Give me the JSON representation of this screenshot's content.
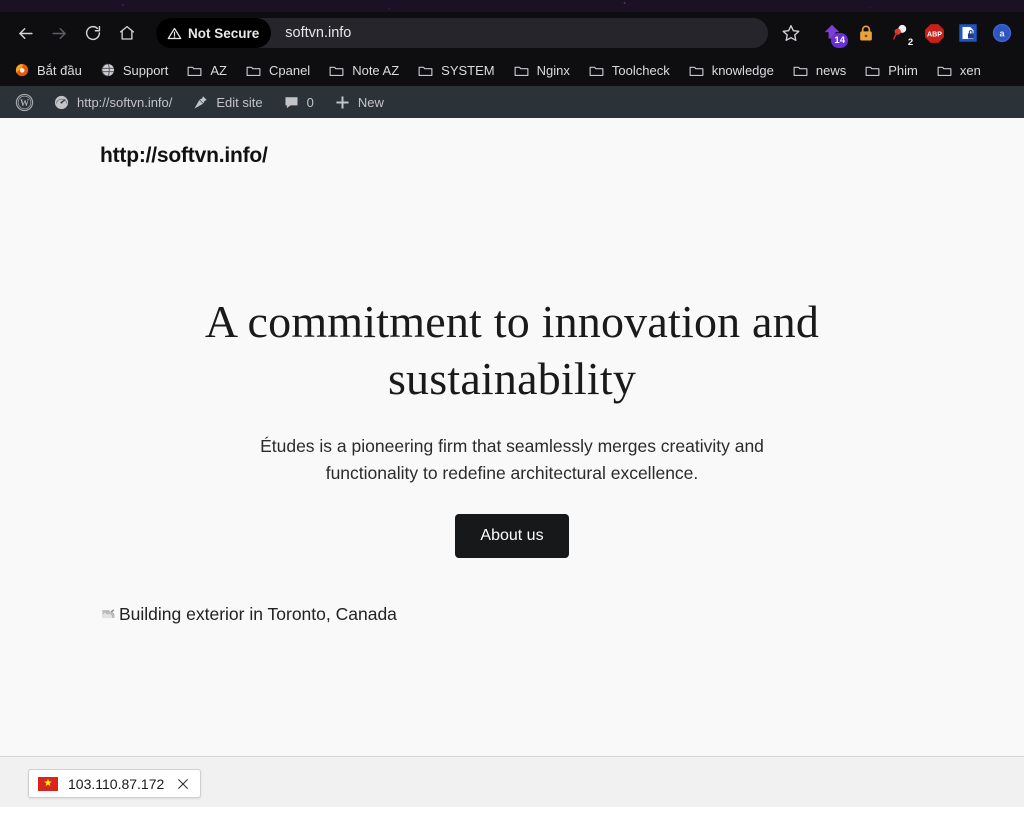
{
  "browser": {
    "nav": {
      "back_title": "Back",
      "forward_title": "Forward",
      "reload_title": "Reload",
      "home_title": "Home",
      "bookmark_title": "Bookmark this page"
    },
    "address": {
      "security_label": "Not Secure",
      "url": "softvn.info"
    },
    "extensions": [
      {
        "name": "upload-extension-icon",
        "badge": "14"
      },
      {
        "name": "padlock-extension-icon",
        "badge": ""
      },
      {
        "name": "cookie-extension-icon",
        "badge": "2"
      },
      {
        "name": "adblock-plus-icon",
        "badge": "",
        "label": "ABP"
      },
      {
        "name": "document-lock-extension-icon",
        "badge": ""
      },
      {
        "name": "avatar-account-icon",
        "badge": ""
      }
    ],
    "bookmarks": [
      {
        "label": "Bắt đầu",
        "icon": "firefox-icon"
      },
      {
        "label": "Support",
        "icon": "globe-icon"
      },
      {
        "label": "AZ",
        "icon": "folder-icon"
      },
      {
        "label": "Cpanel",
        "icon": "folder-icon"
      },
      {
        "label": "Note AZ",
        "icon": "folder-icon"
      },
      {
        "label": "SYSTEM",
        "icon": "folder-icon"
      },
      {
        "label": "Nginx",
        "icon": "folder-icon"
      },
      {
        "label": "Toolcheck",
        "icon": "folder-icon"
      },
      {
        "label": "knowledge",
        "icon": "folder-icon"
      },
      {
        "label": "news",
        "icon": "folder-icon"
      },
      {
        "label": "Phim",
        "icon": "folder-icon"
      },
      {
        "label": "xen",
        "icon": "folder-icon"
      }
    ]
  },
  "adminbar": {
    "items": [
      {
        "label": "",
        "icon": "wordpress-logo-icon"
      },
      {
        "label": "http://softvn.info/",
        "icon": "dashboard-icon"
      },
      {
        "label": "Edit site",
        "icon": "pencil-icon"
      },
      {
        "label": "0",
        "icon": "comment-icon"
      },
      {
        "label": "New",
        "icon": "plus-icon"
      }
    ]
  },
  "page": {
    "site_title": "http://softvn.info/",
    "heading": "A commitment to innovation and sustainability",
    "paragraph": "Études is a pioneering firm that seamlessly merges creativity and functionality to redefine architectural excellence.",
    "cta_label": "About us",
    "broken_image_alt": "Building exterior in Toronto, Canada"
  },
  "bottom": {
    "item_label": "103.110.87.172",
    "close_title": "Close"
  },
  "colors": {
    "chrome_bg": "#0e0e11",
    "urlbar_bg": "#25252b",
    "adminbar_bg": "#2c3338",
    "page_bg": "#f9f9f9",
    "cta_bg": "#16181a",
    "badge_purple": "#6b2fd6",
    "flag_red": "#da251d"
  }
}
